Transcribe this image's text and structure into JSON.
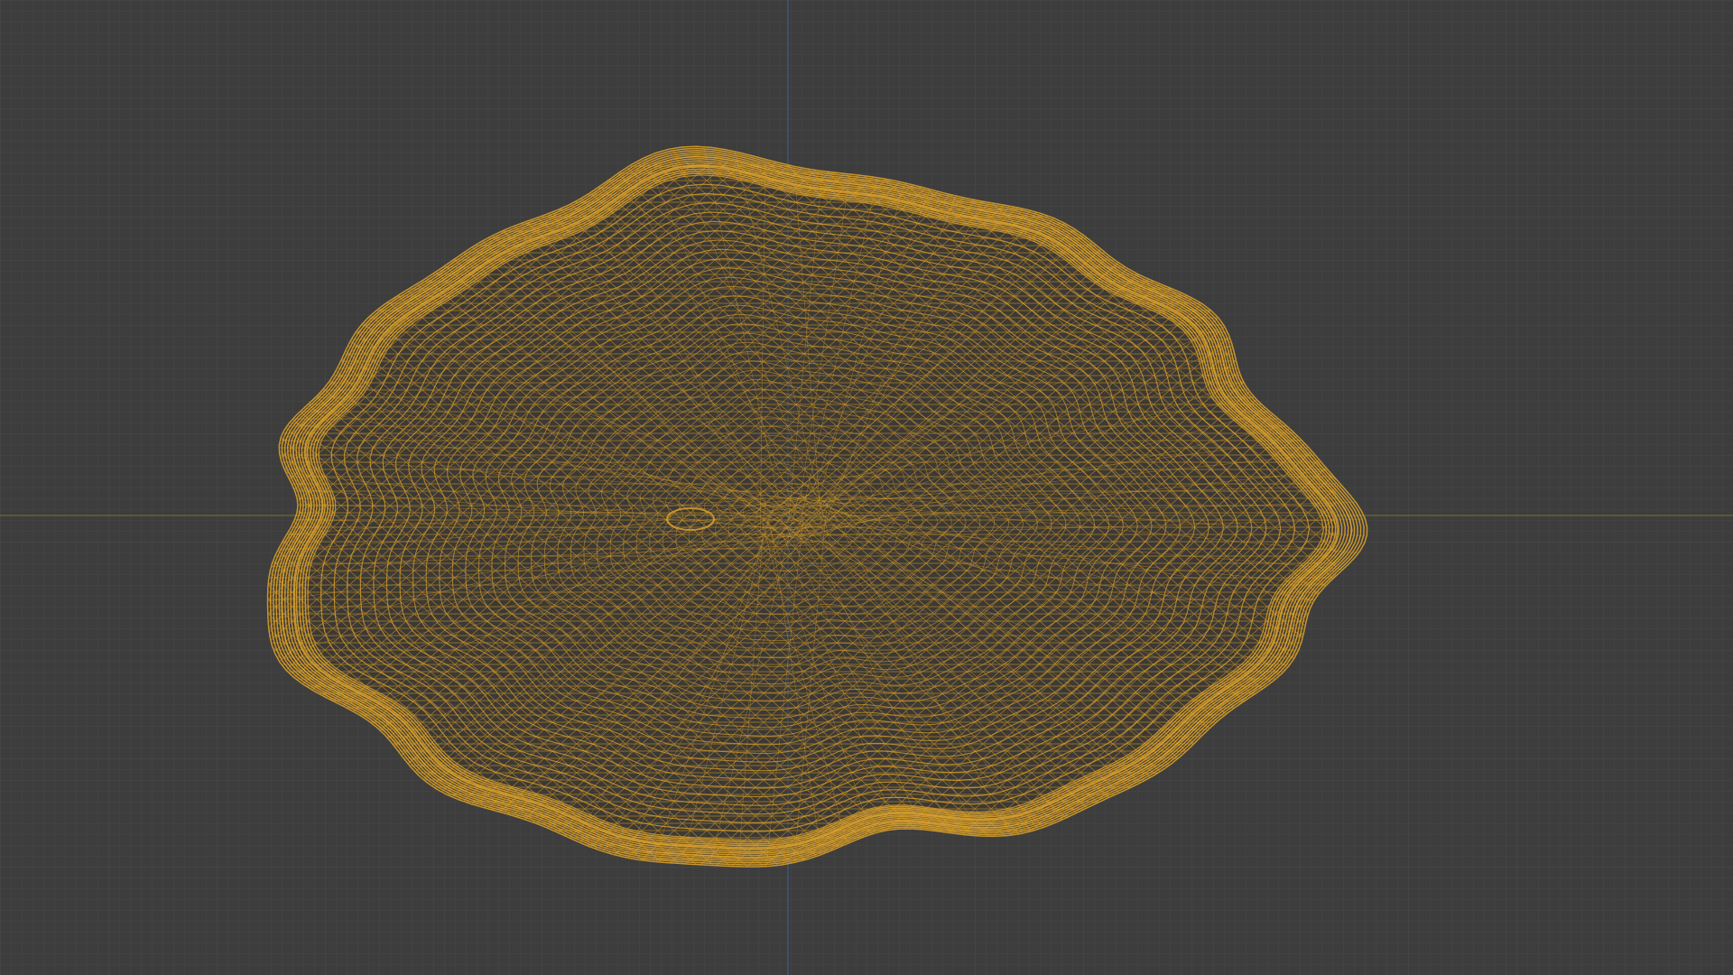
{
  "viewport": {
    "view": "3d-viewport-wireframe",
    "colors": {
      "background": "#3d3d3d",
      "grid_minor": "#464646",
      "grid_major": "#4d4d4d",
      "axis_x": "#6f6a2e",
      "axis_y": "#3f5a78",
      "wire": "#e1a52a"
    },
    "object": {
      "display_mode": "wireframe",
      "selected": true,
      "shape": "irregular-ellipsoid"
    }
  }
}
